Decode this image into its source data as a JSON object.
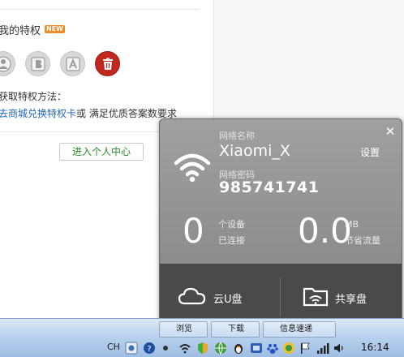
{
  "background": {
    "title": "我的特权",
    "new_badge": "NEW",
    "icons": [
      "user-privilege-icon",
      "b-privilege-icon",
      "a-privilege-icon",
      "trash-privilege-icon"
    ],
    "howto_label": "获取特权方法：",
    "howto_link": "去商城兑换特权卡",
    "howto_rest": "或 满足优质答案数要求",
    "enter_button": "进入个人中心"
  },
  "popup": {
    "close_icon": "close-icon",
    "network_name_label": "网络名称",
    "network_name": "Xiaomi_X",
    "network_password_label": "网络密码",
    "network_password": "985741741",
    "settings_label": "设置",
    "devices_count": "0",
    "devices_unit": "个设备",
    "devices_status": "已连接",
    "traffic_value": "0.0",
    "traffic_unit": "MB",
    "traffic_label": "节省流量",
    "cloud_drive_label": "云U盘",
    "shared_drive_label": "共享盘"
  },
  "taskbar": {
    "tasks": [
      "浏览",
      "下载",
      "信息速递"
    ],
    "ime_label": "CH",
    "clock": "16:14"
  },
  "colors": {
    "popup_top": "#9a9a9a",
    "popup_bottom": "#4a4a4a",
    "link": "#1f66b3",
    "enter_button_text": "#2a8a2a",
    "new_badge": "#f08a24",
    "taskbar": "#b9d1ee"
  }
}
